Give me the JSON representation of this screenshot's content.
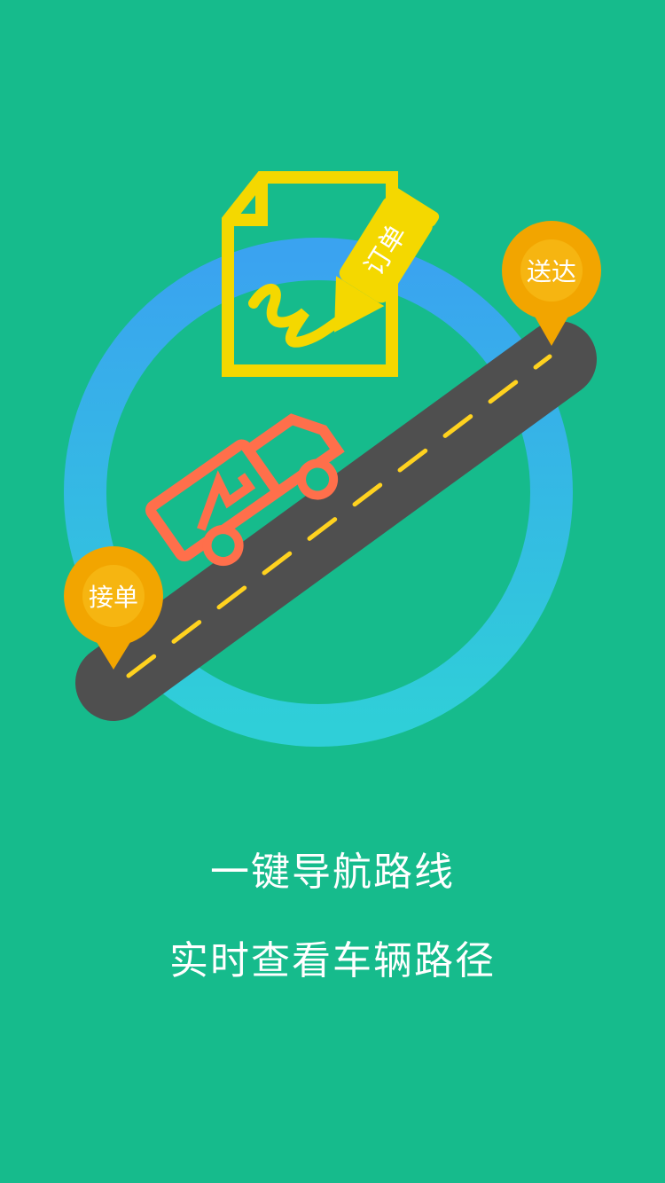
{
  "illustration": {
    "pin_start_label": "接单",
    "pin_end_label": "送达",
    "document_label": "订单"
  },
  "captions": {
    "primary": "一键导航路线",
    "secondary": "实时查看车辆路径"
  },
  "colors": {
    "background": "#16bb8c",
    "ring_top": "#3aa3f0",
    "ring_bottom": "#2fcfd8",
    "road": "#4f4f4f",
    "road_dash": "#ffd21f",
    "pin": "#f2a500",
    "document": "#f4d800",
    "truck": "#ff6f4b"
  }
}
